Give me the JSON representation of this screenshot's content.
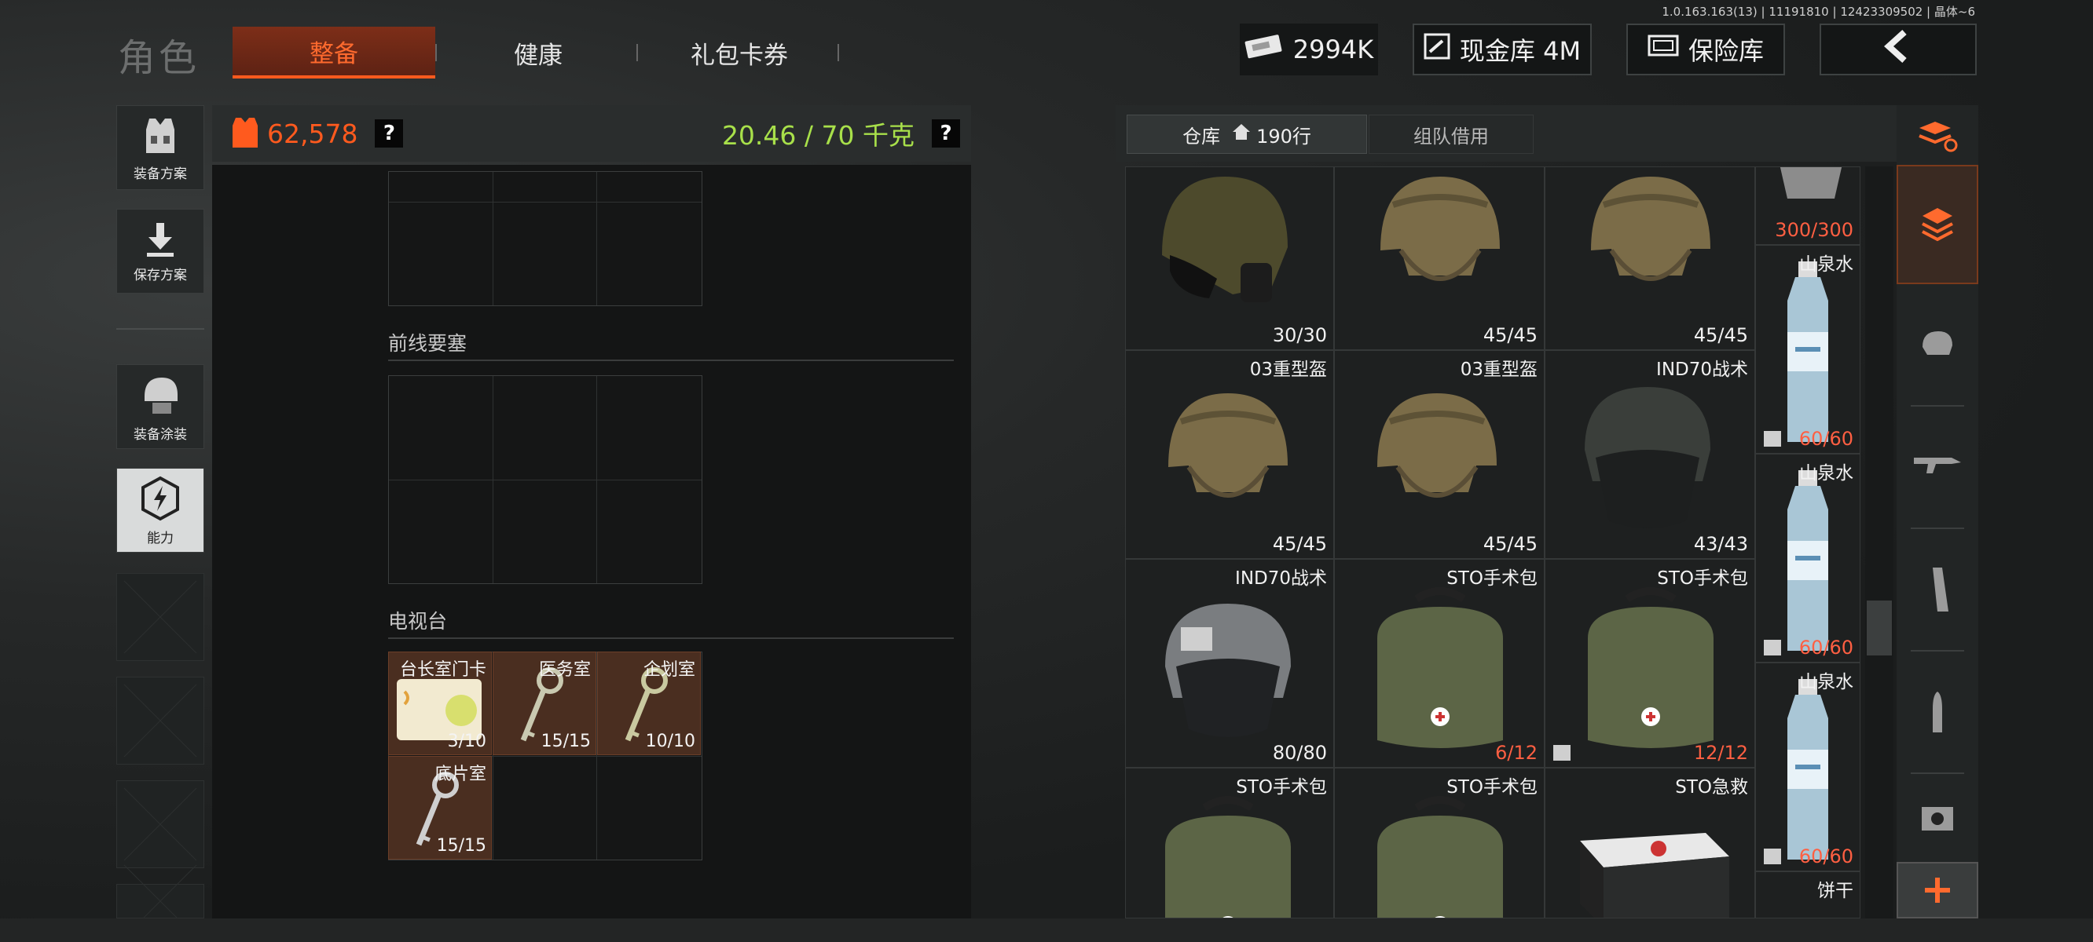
{
  "version": "1.0.163.163(13) | 11191810 | 12423309502 | 晶体~6",
  "header": {
    "title": "角色",
    "tabs": [
      {
        "label": "整备",
        "active": true
      },
      {
        "label": "健康",
        "active": false
      },
      {
        "label": "礼包卡券",
        "active": false
      }
    ],
    "money": "2994K",
    "cash_vault": "现金库 4M",
    "insurance": "保险库"
  },
  "rail": {
    "items": [
      {
        "label": "装备方案"
      },
      {
        "label": "保存方案"
      },
      {
        "label": "装备涂装"
      },
      {
        "label": "能力"
      }
    ]
  },
  "left_panel": {
    "value": "62,578",
    "weight": "20.46 / 70 千克",
    "help": "?",
    "sections": [
      {
        "title": "前线要塞"
      },
      {
        "title": "电视台"
      }
    ],
    "keys": [
      {
        "name": "台长室门卡",
        "count": "3/10"
      },
      {
        "name": "医务室",
        "count": "15/15"
      },
      {
        "name": "企划室",
        "count": "10/10"
      },
      {
        "name": "底片室",
        "count": "15/15"
      }
    ]
  },
  "right_panel": {
    "tabs": [
      {
        "label": "仓库",
        "rows": "190行",
        "active": true
      },
      {
        "label": "组队借用",
        "active": false
      }
    ],
    "items": [
      {
        "name": "",
        "count": "30/30",
        "kind": "helmet-green"
      },
      {
        "name": "",
        "count": "45/45",
        "kind": "helmet-tan"
      },
      {
        "name": "",
        "count": "45/45",
        "kind": "helmet-tan"
      },
      {
        "name": "",
        "count": "300/300",
        "kind": "misc",
        "count_red": true
      },
      {
        "name": "03重型盔",
        "count": "45/45",
        "kind": "helmet-tan"
      },
      {
        "name": "03重型盔",
        "count": "45/45",
        "kind": "helmet-tan"
      },
      {
        "name": "IND70战术",
        "count": "43/43",
        "kind": "helmet-dark"
      },
      {
        "name": "IND70战术",
        "count": "80/80",
        "kind": "helmet-grey"
      },
      {
        "name": "STO手术包",
        "count": "6/12",
        "kind": "bag",
        "count_red": true
      },
      {
        "name": "STO手术包",
        "count": "12/12",
        "kind": "bag",
        "count_red": true
      },
      {
        "name": "STO手术包",
        "count": "",
        "kind": "bag"
      },
      {
        "name": "STO手术包",
        "count": "",
        "kind": "bag"
      },
      {
        "name": "STO急救",
        "count": "",
        "kind": "medkit"
      }
    ],
    "water": [
      {
        "name": "山泉水",
        "count": "60/60"
      },
      {
        "name": "山泉水",
        "count": "60/60"
      },
      {
        "name": "山泉水",
        "count": "60/60"
      }
    ],
    "biscuit": "饼干"
  },
  "colors": {
    "accent": "#ff5a1e",
    "weight_green": "#a8e04a",
    "red_count": "#ff5f42"
  }
}
